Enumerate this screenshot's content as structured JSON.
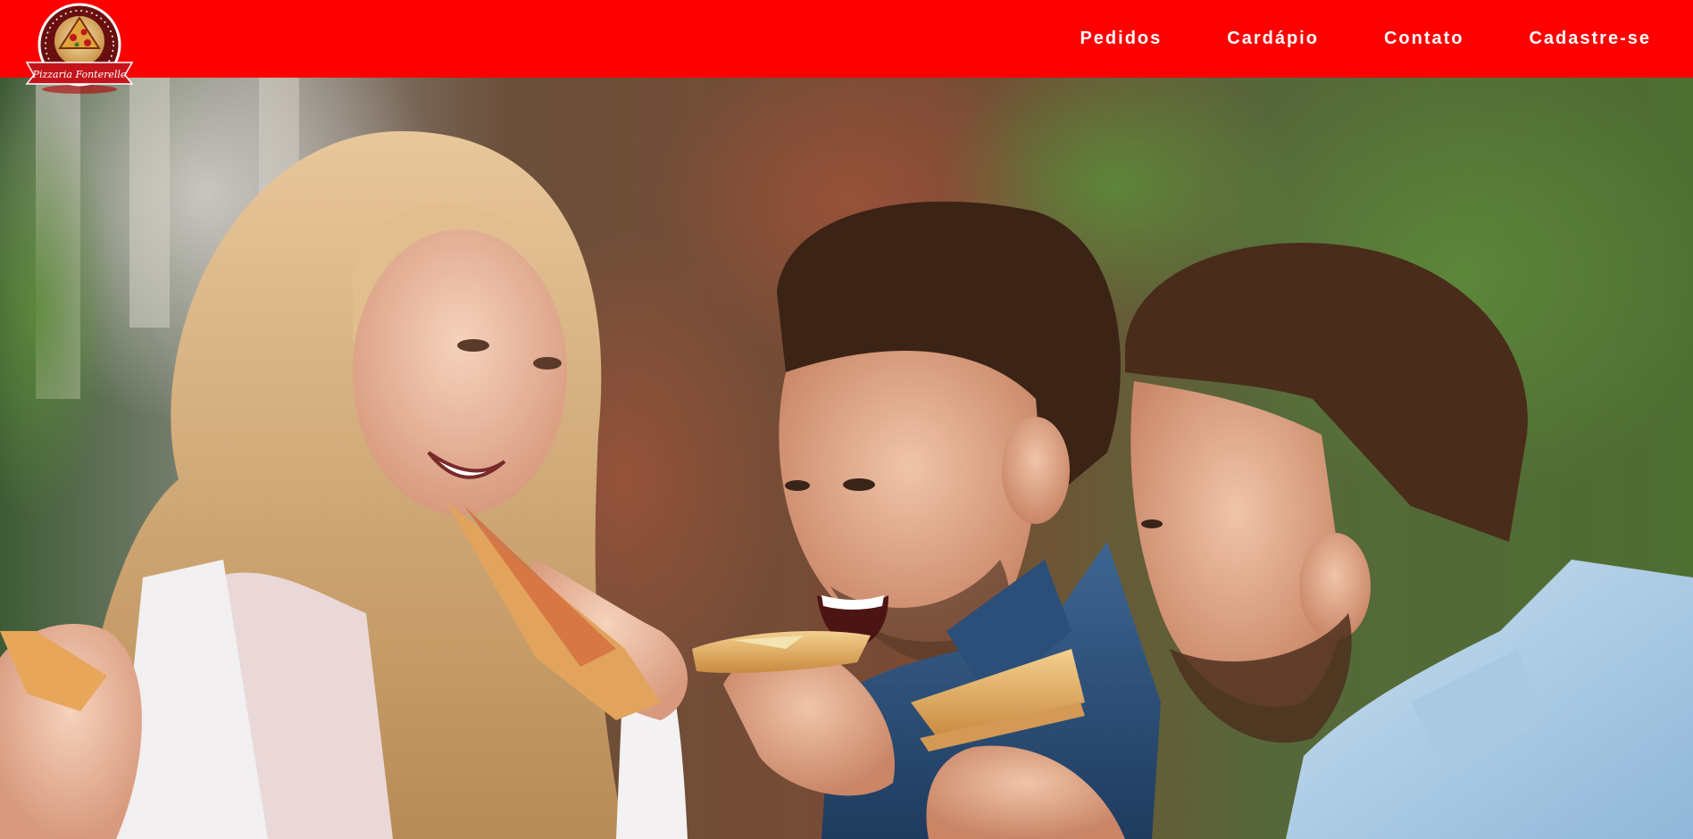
{
  "header": {
    "background": "#ff0000",
    "logo": {
      "text": "Pizzaria Fonterelle",
      "icon": "pizza-badge-logo"
    },
    "nav": [
      {
        "label": "Pedidos"
      },
      {
        "label": "Cardápio"
      },
      {
        "label": "Contato"
      },
      {
        "label": "Cadastre-se"
      }
    ]
  },
  "hero": {
    "subject": "three-friends-eating-pizza-photo"
  }
}
